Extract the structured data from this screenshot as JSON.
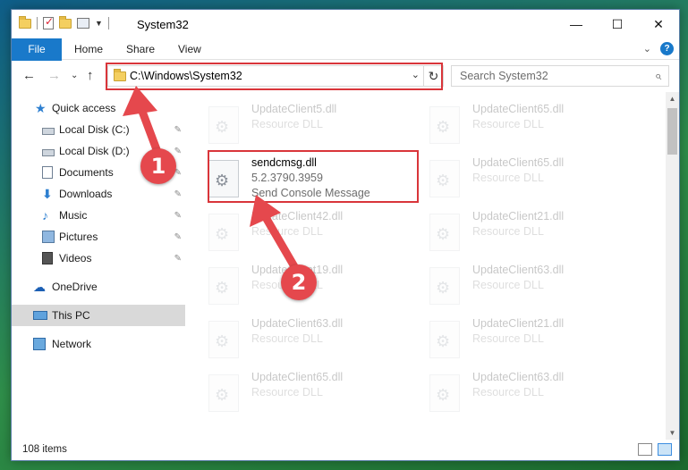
{
  "window": {
    "title": "System32",
    "controls": {
      "minimize": "—",
      "maximize": "☐",
      "close": "✕"
    }
  },
  "ribbon": {
    "tabs": [
      {
        "label": "File"
      },
      {
        "label": "Home"
      },
      {
        "label": "Share"
      },
      {
        "label": "View"
      }
    ],
    "expand_icon": "⌄",
    "help_label": "?"
  },
  "navigation": {
    "back": "←",
    "forward": "→",
    "recent": "⌄",
    "up": "↑",
    "address": "C:\\Windows\\System32",
    "address_chevron": "⌄",
    "refresh": "↻",
    "search_placeholder": "Search System32",
    "search_icon": "⌕"
  },
  "sidebar": {
    "items": [
      {
        "label": "Quick access",
        "icon": "star-icon",
        "pinned": false
      },
      {
        "label": "Local Disk (C:)",
        "icon": "disk-icon",
        "pinned": true
      },
      {
        "label": "Local Disk (D:)",
        "icon": "disk-icon",
        "pinned": true
      },
      {
        "label": "Documents",
        "icon": "document-icon",
        "pinned": true
      },
      {
        "label": "Downloads",
        "icon": "download-icon",
        "pinned": true
      },
      {
        "label": "Music",
        "icon": "music-icon",
        "pinned": true
      },
      {
        "label": "Pictures",
        "icon": "pictures-icon",
        "pinned": true
      },
      {
        "label": "Videos",
        "icon": "videos-icon",
        "pinned": true
      },
      {
        "label": "OneDrive",
        "icon": "cloud-icon",
        "pinned": false
      },
      {
        "label": "This PC",
        "icon": "computer-icon",
        "pinned": false,
        "selected": true
      },
      {
        "label": "Network",
        "icon": "network-icon",
        "pinned": false
      }
    ],
    "pin_glyph": "📌"
  },
  "files": {
    "selected": {
      "name": "sendcmsg.dll",
      "version": "5.2.3790.3959",
      "description": "Send Console Message"
    },
    "background": [
      {
        "name": "UpdateClient5.dll",
        "type": "Resource DLL"
      },
      {
        "name": "UpdateClient65.dll",
        "type": "Resource DLL"
      },
      {
        "name": "UpdateClient65.dll",
        "type": "Resource DLL"
      },
      {
        "name": "UpdateClient42.dll",
        "type": "Resource DLL"
      },
      {
        "name": "UpdateClient21.dll",
        "type": "Resource DLL"
      },
      {
        "name": "UpdateClient19.dll",
        "type": "Resource DLL"
      },
      {
        "name": "UpdateClient63.dll",
        "type": "Resource DLL"
      },
      {
        "name": "UpdateClient63.dll",
        "type": "Resource DLL"
      },
      {
        "name": "UpdateClient21.dll",
        "type": "Resource DLL"
      },
      {
        "name": "UpdateClient65.dll",
        "type": "Resource DLL"
      },
      {
        "name": "UpdateClient63.dll",
        "type": "Resource DLL"
      }
    ]
  },
  "status": {
    "item_count": "108 items"
  },
  "annotations": {
    "step1": "1",
    "step2": "2",
    "color": "#e5484d"
  }
}
